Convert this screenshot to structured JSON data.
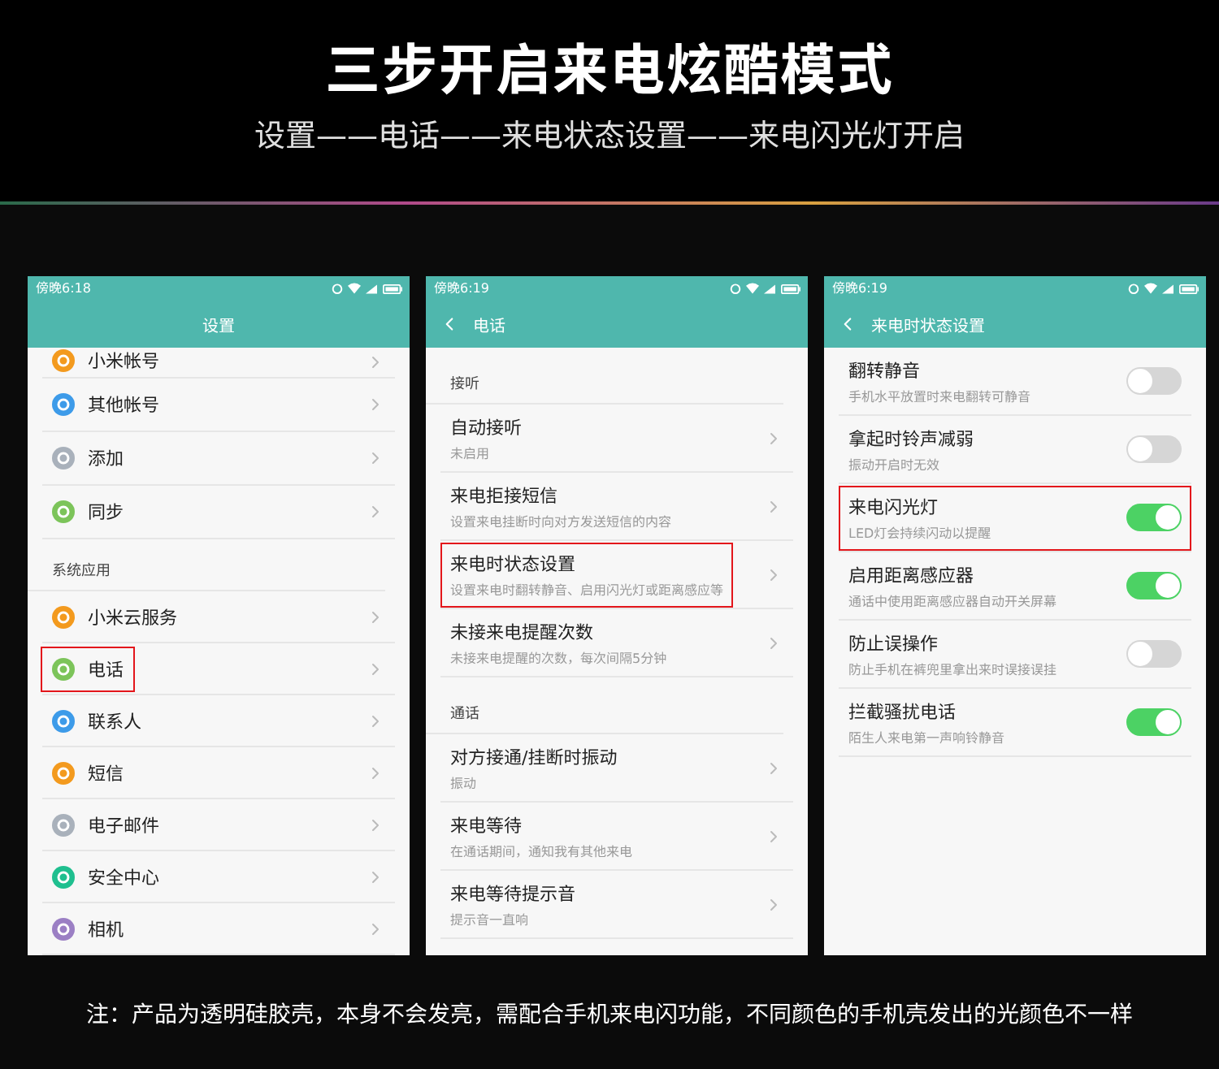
{
  "header": {
    "title": "三步开启来电炫酷模式",
    "subtitle": "设置——电话——来电状态设置——来电闪光灯开启"
  },
  "screens": [
    {
      "time": "傍晚6:18",
      "title": "设置",
      "back": false,
      "sections": [
        {
          "items": [
            {
              "title": "小米帐号",
              "color": "#f39a1e",
              "partial": true,
              "highlighted": false
            },
            {
              "title": "其他帐号",
              "color": "#3d9be9",
              "highlighted": false
            },
            {
              "title": "添加",
              "color": "#a9b1bb",
              "highlighted": false
            },
            {
              "title": "同步",
              "color": "#7cc45a",
              "highlighted": false
            }
          ]
        },
        {
          "label": "系统应用",
          "items": [
            {
              "title": "小米云服务",
              "color": "#f39a1e",
              "highlighted": false
            },
            {
              "title": "电话",
              "color": "#7cc45a",
              "highlighted": true
            },
            {
              "title": "联系人",
              "color": "#3d9be9",
              "highlighted": false
            },
            {
              "title": "短信",
              "color": "#f39a1e",
              "highlighted": false
            },
            {
              "title": "电子邮件",
              "color": "#a9b1bb",
              "highlighted": false
            },
            {
              "title": "安全中心",
              "color": "#1fbf8f",
              "highlighted": false
            },
            {
              "title": "相机",
              "color": "#9b7fc4",
              "highlighted": false
            }
          ]
        }
      ]
    },
    {
      "time": "傍晚6:19",
      "title": "电话",
      "back": true,
      "sections": [
        {
          "label": "接听",
          "items": [
            {
              "title": "自动接听",
              "subtitle": "未启用",
              "highlighted": false
            },
            {
              "title": "来电拒接短信",
              "subtitle": "设置来电挂断时向对方发送短信的内容",
              "highlighted": false
            },
            {
              "title": "来电时状态设置",
              "subtitle": "设置来电时翻转静音、启用闪光灯或距离感应等",
              "highlighted": true
            },
            {
              "title": "未接来电提醒次数",
              "subtitle": "未接来电提醒的次数，每次间隔5分钟",
              "highlighted": false
            }
          ]
        },
        {
          "label": "通话",
          "items": [
            {
              "title": "对方接通/挂断时振动",
              "subtitle": "振动",
              "highlighted": false
            },
            {
              "title": "来电等待",
              "subtitle": "在通话期间，通知我有其他来电",
              "highlighted": false
            },
            {
              "title": "来电等待提示音",
              "subtitle": "提示音一直响",
              "highlighted": false
            }
          ]
        }
      ]
    },
    {
      "time": "傍晚6:19",
      "title": "来电时状态设置",
      "back": true,
      "sections": [
        {
          "items": [
            {
              "title": "翻转静音",
              "subtitle": "手机水平放置时来电翻转可静音",
              "on": false,
              "highlighted": false
            },
            {
              "title": "拿起时铃声减弱",
              "subtitle": "振动开启时无效",
              "on": false,
              "highlighted": false
            },
            {
              "title": "来电闪光灯",
              "subtitle": "LED灯会持续闪动以提醒",
              "on": true,
              "highlighted": true
            },
            {
              "title": "启用距离感应器",
              "subtitle": "通话中使用距离感应器自动开关屏幕",
              "on": true,
              "highlighted": false
            },
            {
              "title": "防止误操作",
              "subtitle": "防止手机在裤兜里拿出来时误接误挂",
              "on": false,
              "highlighted": false
            },
            {
              "title": "拦截骚扰电话",
              "subtitle": "陌生人来电第一声响铃静音",
              "on": true,
              "highlighted": false
            }
          ]
        }
      ]
    }
  ],
  "footer": "注：产品为透明硅胶壳，本身不会发亮，需配合手机来电闪功能，不同颜色的手机壳发出的光颜色不一样"
}
